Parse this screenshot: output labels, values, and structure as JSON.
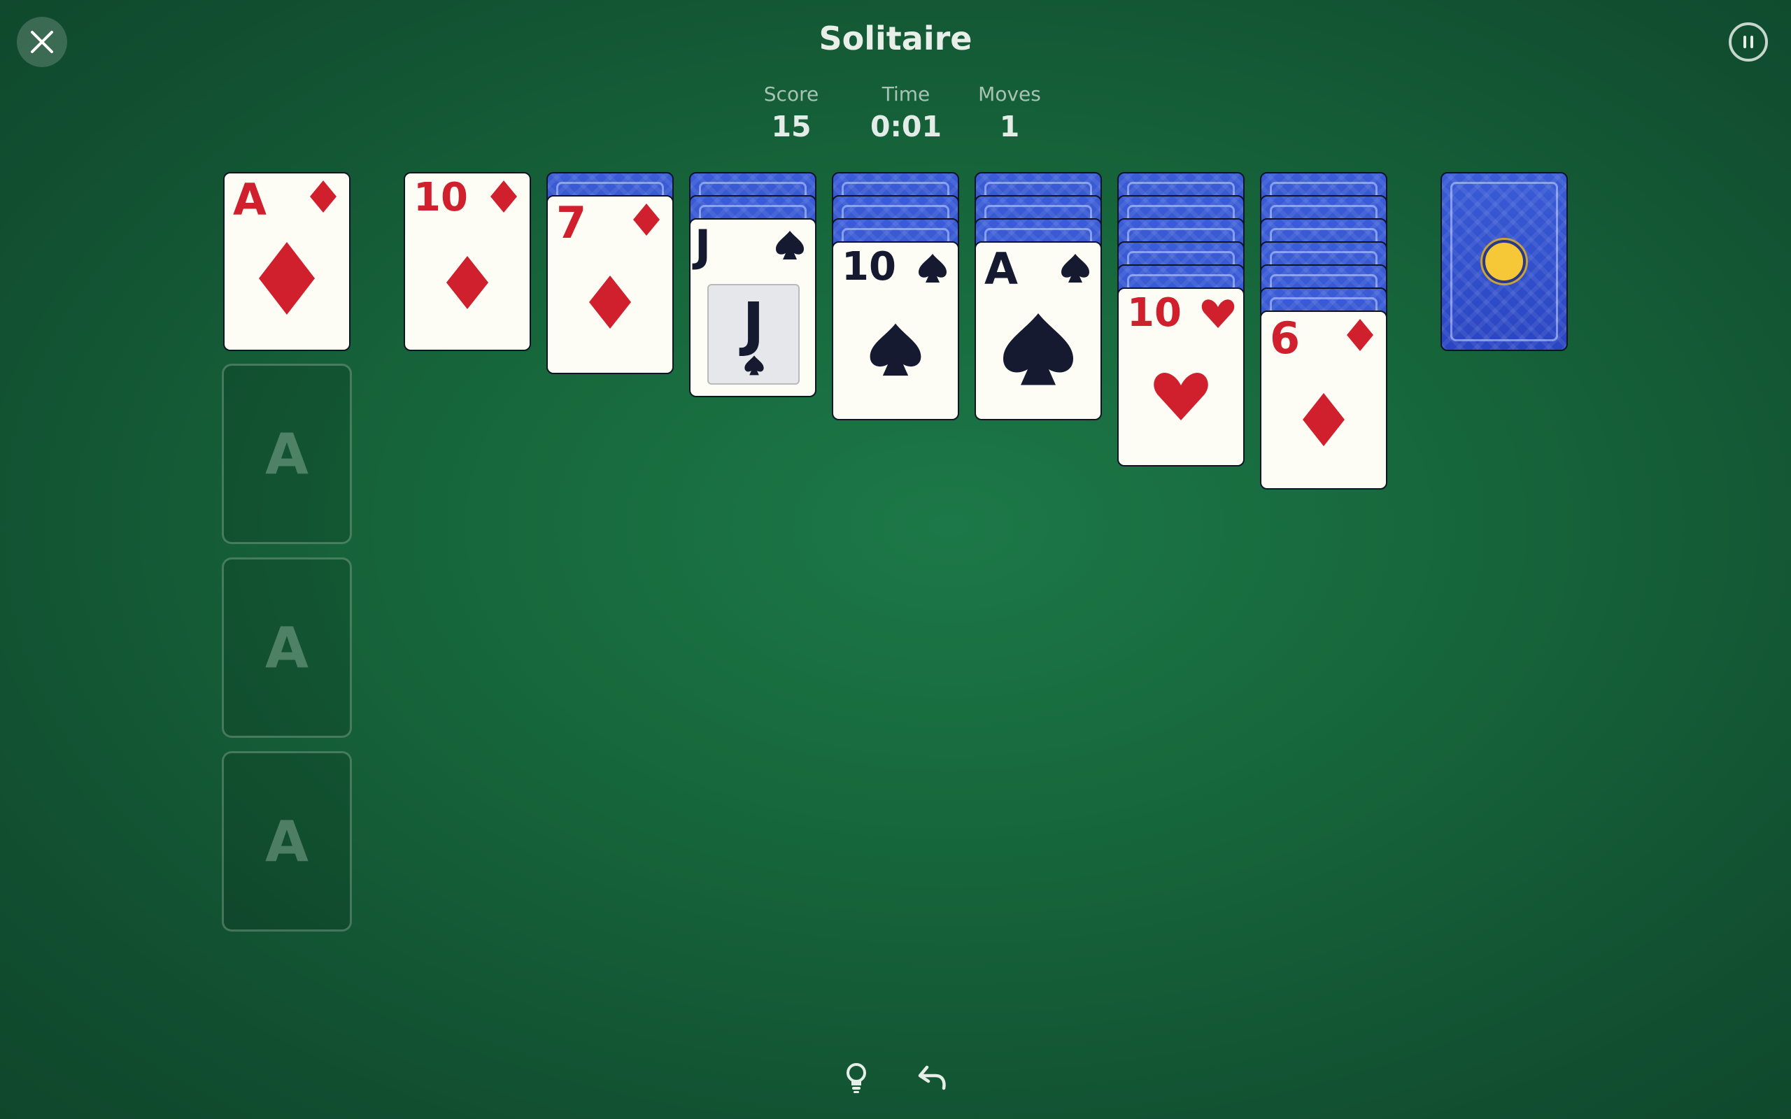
{
  "header": {
    "title": "Solitaire",
    "stats": [
      {
        "label": "Score",
        "value": "15"
      },
      {
        "label": "Time",
        "value": "0:01"
      },
      {
        "label": "Moves",
        "value": "1"
      }
    ]
  },
  "icons": {
    "close": "close-icon",
    "pause": "pause-icon",
    "hint": "lightbulb-icon",
    "undo": "undo-icon"
  },
  "colors": {
    "felt": "#1c7848",
    "red_suit": "#d0202e",
    "black_suit": "#151a30",
    "card_back": "#2a45c2"
  },
  "foundations": [
    {
      "rank": "A",
      "suit": "diamond",
      "color": "red"
    },
    {
      "placeholder": "A"
    },
    {
      "placeholder": "A"
    },
    {
      "placeholder": "A"
    }
  ],
  "tableau": [
    {
      "face_down": 0,
      "rank": "10",
      "suit": "diamond",
      "color": "red"
    },
    {
      "face_down": 1,
      "rank": "7",
      "suit": "diamond",
      "color": "red"
    },
    {
      "face_down": 2,
      "rank": "J",
      "suit": "spade",
      "color": "black"
    },
    {
      "face_down": 3,
      "rank": "10",
      "suit": "spade",
      "color": "black"
    },
    {
      "face_down": 3,
      "rank": "A",
      "suit": "spade",
      "color": "black"
    },
    {
      "face_down": 5,
      "rank": "10",
      "suit": "heart",
      "color": "red"
    },
    {
      "face_down": 6,
      "rank": "6",
      "suit": "diamond",
      "color": "red"
    }
  ],
  "stock": {
    "face_down": true
  }
}
